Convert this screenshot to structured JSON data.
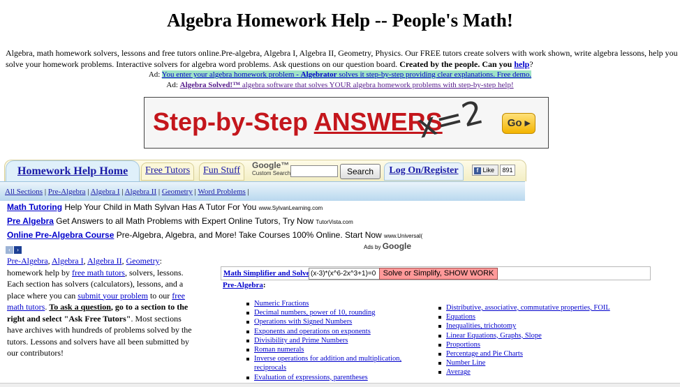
{
  "page_title": "Algebra Homework Help -- People's Math!",
  "intro": {
    "text": "Algebra, math homework solvers, lessons and free tutors online.Pre-algebra, Algebra I, Algebra II, Geometry, Physics. Our FREE tutors create solvers with work shown, write algebra lessons, help you solve your homework problems. Interactive solvers for algebra word problems. Ask questions on our question board.",
    "bold": "Created by the people. Can you",
    "help_link": "help",
    "end": "?"
  },
  "ad_line_1": {
    "prefix": "Ad:",
    "text_a": "You enter your algebra homework problem -",
    "brand": "Algebrator",
    "text_b": "solves it step-by-step providing clear explanations. Free demo."
  },
  "ad_line_2": {
    "prefix": "Ad:",
    "brand": "Algebra Solved!™",
    "text": "algebra software that solves YOUR algebra homework problems with step-by-step help!"
  },
  "banner": {
    "slogan_a": "Step-by-Step",
    "slogan_b": "ANSWERS",
    "formula": "x=2",
    "go_label": "Go ▸"
  },
  "tabs": {
    "home": "Homework Help Home",
    "free_tutors": "Free Tutors",
    "fun_stuff": "Fun Stuff",
    "login": "Log On/Register"
  },
  "google_search": {
    "logo": "Google™",
    "custom": "Custom Search",
    "button": "Search",
    "value": ""
  },
  "facebook": {
    "like": "Like",
    "count": "891",
    "icon": "f"
  },
  "subnav": [
    "All Sections",
    "Pre-Algebra",
    "Algebra I",
    "Algebra II",
    "Geometry",
    "Word Problems"
  ],
  "sponsored": [
    {
      "title": "Math Tutoring",
      "text": "Help Your Child in Math Sylvan Has A Tutor For You",
      "domain": "www.SylvanLearning.com"
    },
    {
      "title": "Pre Algebra",
      "text": "Get Answers to all Math Problems with Expert Online Tutors, Try Now",
      "domain": "TutorVista.com"
    },
    {
      "title": "Online Pre-Algebra Course",
      "text": "Pre-Algebra, Algebra, and More! Take Courses 100% Online. Start Now",
      "domain": "www.Universal("
    }
  ],
  "ads_by": {
    "prefix": "Ads by",
    "brand": "Google"
  },
  "nav_arrows": {
    "prev": "‹",
    "next": "›"
  },
  "left_column": {
    "links": [
      "Pre-Algebra",
      "Algebra I",
      "Algebra II",
      "Geometry"
    ],
    "text_a": "homework help by",
    "link_tutors": "free math tutors",
    "text_b": ", solvers, lessons. Each section has solvers (calculators), lessons, and a place where you can",
    "link_submit": "submit your problem",
    "text_c": "to our",
    "link_free": "free math tutors",
    "bold_question": "To ask a question",
    "bold_rest": ", go to a section to the right and select \"Ask Free Tutors\"",
    "text_d": ". Most sections have archives with hundreds of problems solved by the tutors. Lessons and solvers have all been submitted by our contributors!"
  },
  "simplifier": {
    "label": "Math Simplifier and Solver",
    "colon": ":",
    "input_value": "(x-3)*(x^6-2x^3+1)=0",
    "button": "Solve or Simplify, SHOW WORK"
  },
  "section_heading": "Pre-Algebra",
  "topics_left": [
    "Numeric Fractions",
    "Decimal numbers, power of 10, rounding",
    "Operations with Signed Numbers",
    "Exponents and operations on exponents",
    "Divisibility and Prime Numbers",
    "Roman numerals",
    "Inverse operations for addition and multiplication, reciprocals",
    "Evaluation of expressions, parentheses"
  ],
  "topics_right": [
    "Distributive, associative, commutative properties, FOIL",
    "Equations",
    "Inequalities, trichotomy",
    "Linear Equations, Graphs, Slope",
    "Proportions",
    "Percentage and Pie Charts",
    "Number Line",
    "Average"
  ]
}
